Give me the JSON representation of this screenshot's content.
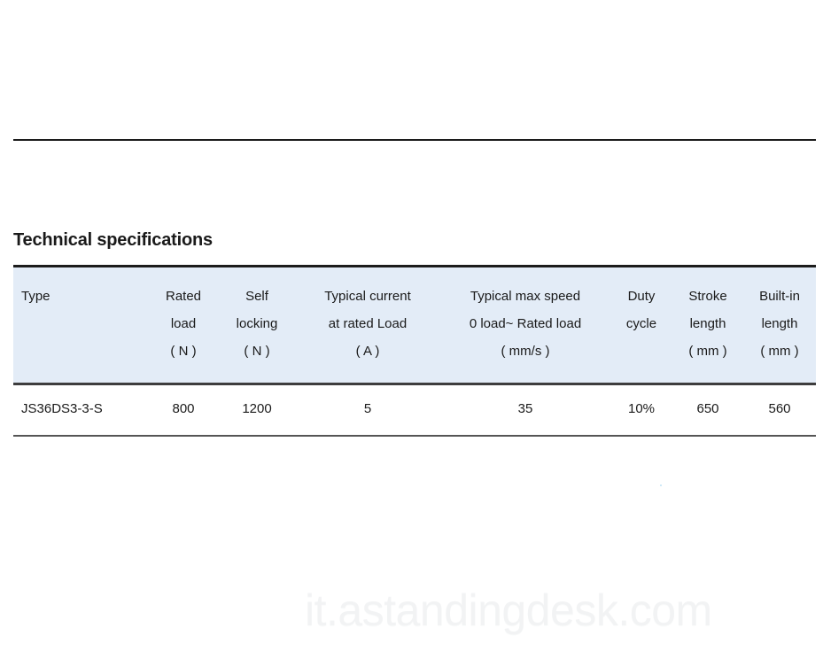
{
  "document": {
    "section_heading": "Technical specifications",
    "watermark": "it.astandingdesk.com"
  },
  "table": {
    "columns": [
      {
        "key": "type",
        "line1": "Type",
        "line2": "",
        "line3": ""
      },
      {
        "key": "rated_load",
        "line1": "Rated",
        "line2": "load",
        "line3": "( N )"
      },
      {
        "key": "self_locking",
        "line1": "Self",
        "line2": "locking",
        "line3": "( N )"
      },
      {
        "key": "typical_current",
        "line1": "Typical current",
        "line2": "at rated Load",
        "line3": "( A )"
      },
      {
        "key": "typical_max_speed",
        "line1": "Typical max speed",
        "line2": "0 load~ Rated load",
        "line3": "( mm/s )"
      },
      {
        "key": "duty_cycle",
        "line1": "Duty",
        "line2": "cycle",
        "line3": ""
      },
      {
        "key": "stroke_length",
        "line1": "Stroke",
        "line2": "length",
        "line3": "( mm )"
      },
      {
        "key": "builtin_length",
        "line1": "Built-in",
        "line2": "length",
        "line3": "( mm )"
      }
    ],
    "rows": [
      {
        "type": "JS36DS3-3-S",
        "rated_load": "800",
        "self_locking": "1200",
        "typical_current": "5",
        "typical_max_speed": "35",
        "duty_cycle": "10%",
        "stroke_length": "650",
        "builtin_length": "560"
      }
    ]
  },
  "colors": {
    "header_background": "#e3ecf7",
    "table_top_border": "#1c1c1c",
    "table_divider": "#3d3d3d",
    "table_bottom_border": "#555555",
    "text": "#1a1a1a",
    "watermark": "#f2f3f4"
  }
}
